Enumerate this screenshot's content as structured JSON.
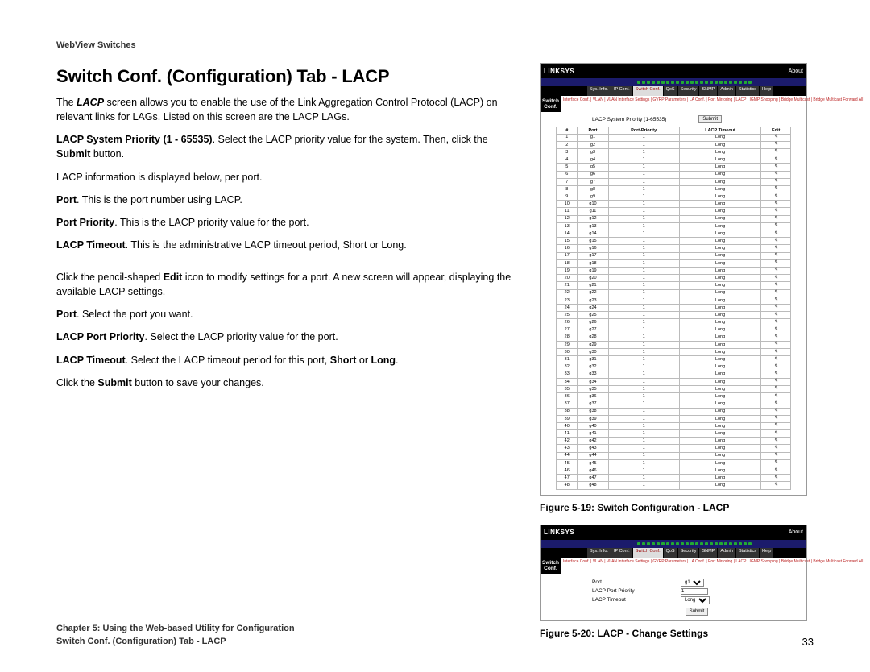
{
  "header": {
    "product": "WebView Switches"
  },
  "title": "Switch Conf. (Configuration) Tab - LACP",
  "paragraphs": {
    "p1_a": "The ",
    "p1_b": "LACP",
    "p1_c": " screen allows you to enable the use of the Link Aggregation Control Protocol (LACP) on relevant links for LAGs. Listed on this screen are the LACP LAGs.",
    "p2_a": "LACP System Priority (1 - 65535)",
    "p2_b": ". Select the LACP priority value for the system. Then, click the ",
    "p2_c": "Submit",
    "p2_d": " button.",
    "p3": "LACP information is displayed below, per port.",
    "p4_a": "Port",
    "p4_b": ". This is the port number using LACP.",
    "p5_a": "Port Priority",
    "p5_b": ". This is the LACP priority value for the port.",
    "p6_a": "LACP Timeout",
    "p6_b": ". This is the administrative LACP timeout period, Short or Long.",
    "p7_a": "Click the pencil-shaped ",
    "p7_b": "Edit",
    "p7_c": " icon to modify settings for a port. A new screen will appear, displaying the available LACP settings.",
    "p8_a": "Port",
    "p8_b": ". Select the port you want.",
    "p9_a": "LACP Port Priority",
    "p9_b": ". Select the LACP priority value for the port.",
    "p10_a": "LACP Timeout",
    "p10_b": ". Select the LACP timeout period for this port, ",
    "p10_c": "Short",
    "p10_d": " or ",
    "p10_e": "Long",
    "p10_f": ".",
    "p11_a": "Click the ",
    "p11_b": "Submit",
    "p11_c": " button to save your changes."
  },
  "figure1": {
    "caption": "Figure 5-19: Switch Configuration - LACP",
    "brand": "LINKSYS",
    "about": "About",
    "switch_conf_label": "Switch Conf.",
    "tabs": [
      "Sys. Info.",
      "IP Conf.",
      "Switch Conf.",
      "QoS",
      "Security",
      "SNMP",
      "Admin",
      "Statistics",
      "Help"
    ],
    "subtabs": "Interface Conf. | VLAN | VLAN Interface Settings | GVRP Parameters | LA Conf. | Port Mirroring | LACP | IGMP Snooping | Bridge Multicast | Bridge Multicast Forward All",
    "priority_label": "LACP System Priority (1-65535)",
    "submit_label": "Submit",
    "table_headers": [
      "#",
      "Port",
      "Port-Priority",
      "LACP Timeout",
      "Edit"
    ],
    "timeout_val": "Long",
    "priority_val": "1",
    "edit_glyph": "✎"
  },
  "figure2": {
    "caption": "Figure 5-20: LACP - Change Settings",
    "port_label": "Port",
    "port_value": "g1",
    "priority_label": "LACP Port Priority",
    "priority_value": "1",
    "timeout_label": "LACP Timeout",
    "timeout_value": "Long",
    "submit_label": "Submit"
  },
  "footer": {
    "line1": "Chapter 5: Using the Web-based Utility for Configuration",
    "line2": "Switch Conf. (Configuration) Tab - LACP",
    "page": "33"
  },
  "chart_data": {
    "type": "table",
    "title": "LACP Port Table",
    "columns": [
      "#",
      "Port",
      "Port-Priority",
      "LACP Timeout"
    ],
    "rows": [
      [
        1,
        "g1",
        1,
        "Long"
      ],
      [
        2,
        "g2",
        1,
        "Long"
      ],
      [
        3,
        "g3",
        1,
        "Long"
      ],
      [
        4,
        "g4",
        1,
        "Long"
      ],
      [
        5,
        "g5",
        1,
        "Long"
      ],
      [
        6,
        "g6",
        1,
        "Long"
      ],
      [
        7,
        "g7",
        1,
        "Long"
      ],
      [
        8,
        "g8",
        1,
        "Long"
      ],
      [
        9,
        "g9",
        1,
        "Long"
      ],
      [
        10,
        "g10",
        1,
        "Long"
      ],
      [
        11,
        "g11",
        1,
        "Long"
      ],
      [
        12,
        "g12",
        1,
        "Long"
      ],
      [
        13,
        "g13",
        1,
        "Long"
      ],
      [
        14,
        "g14",
        1,
        "Long"
      ],
      [
        15,
        "g15",
        1,
        "Long"
      ],
      [
        16,
        "g16",
        1,
        "Long"
      ],
      [
        17,
        "g17",
        1,
        "Long"
      ],
      [
        18,
        "g18",
        1,
        "Long"
      ],
      [
        19,
        "g19",
        1,
        "Long"
      ],
      [
        20,
        "g20",
        1,
        "Long"
      ],
      [
        21,
        "g21",
        1,
        "Long"
      ],
      [
        22,
        "g22",
        1,
        "Long"
      ],
      [
        23,
        "g23",
        1,
        "Long"
      ],
      [
        24,
        "g24",
        1,
        "Long"
      ],
      [
        25,
        "g25",
        1,
        "Long"
      ],
      [
        26,
        "g26",
        1,
        "Long"
      ],
      [
        27,
        "g27",
        1,
        "Long"
      ],
      [
        28,
        "g28",
        1,
        "Long"
      ],
      [
        29,
        "g29",
        1,
        "Long"
      ],
      [
        30,
        "g30",
        1,
        "Long"
      ],
      [
        31,
        "g31",
        1,
        "Long"
      ],
      [
        32,
        "g32",
        1,
        "Long"
      ],
      [
        33,
        "g33",
        1,
        "Long"
      ],
      [
        34,
        "g34",
        1,
        "Long"
      ],
      [
        35,
        "g35",
        1,
        "Long"
      ],
      [
        36,
        "g36",
        1,
        "Long"
      ],
      [
        37,
        "g37",
        1,
        "Long"
      ],
      [
        38,
        "g38",
        1,
        "Long"
      ],
      [
        39,
        "g39",
        1,
        "Long"
      ],
      [
        40,
        "g40",
        1,
        "Long"
      ],
      [
        41,
        "g41",
        1,
        "Long"
      ],
      [
        42,
        "g42",
        1,
        "Long"
      ],
      [
        43,
        "g43",
        1,
        "Long"
      ],
      [
        44,
        "g44",
        1,
        "Long"
      ],
      [
        45,
        "g45",
        1,
        "Long"
      ],
      [
        46,
        "g46",
        1,
        "Long"
      ],
      [
        47,
        "g47",
        1,
        "Long"
      ],
      [
        48,
        "g48",
        1,
        "Long"
      ]
    ]
  }
}
